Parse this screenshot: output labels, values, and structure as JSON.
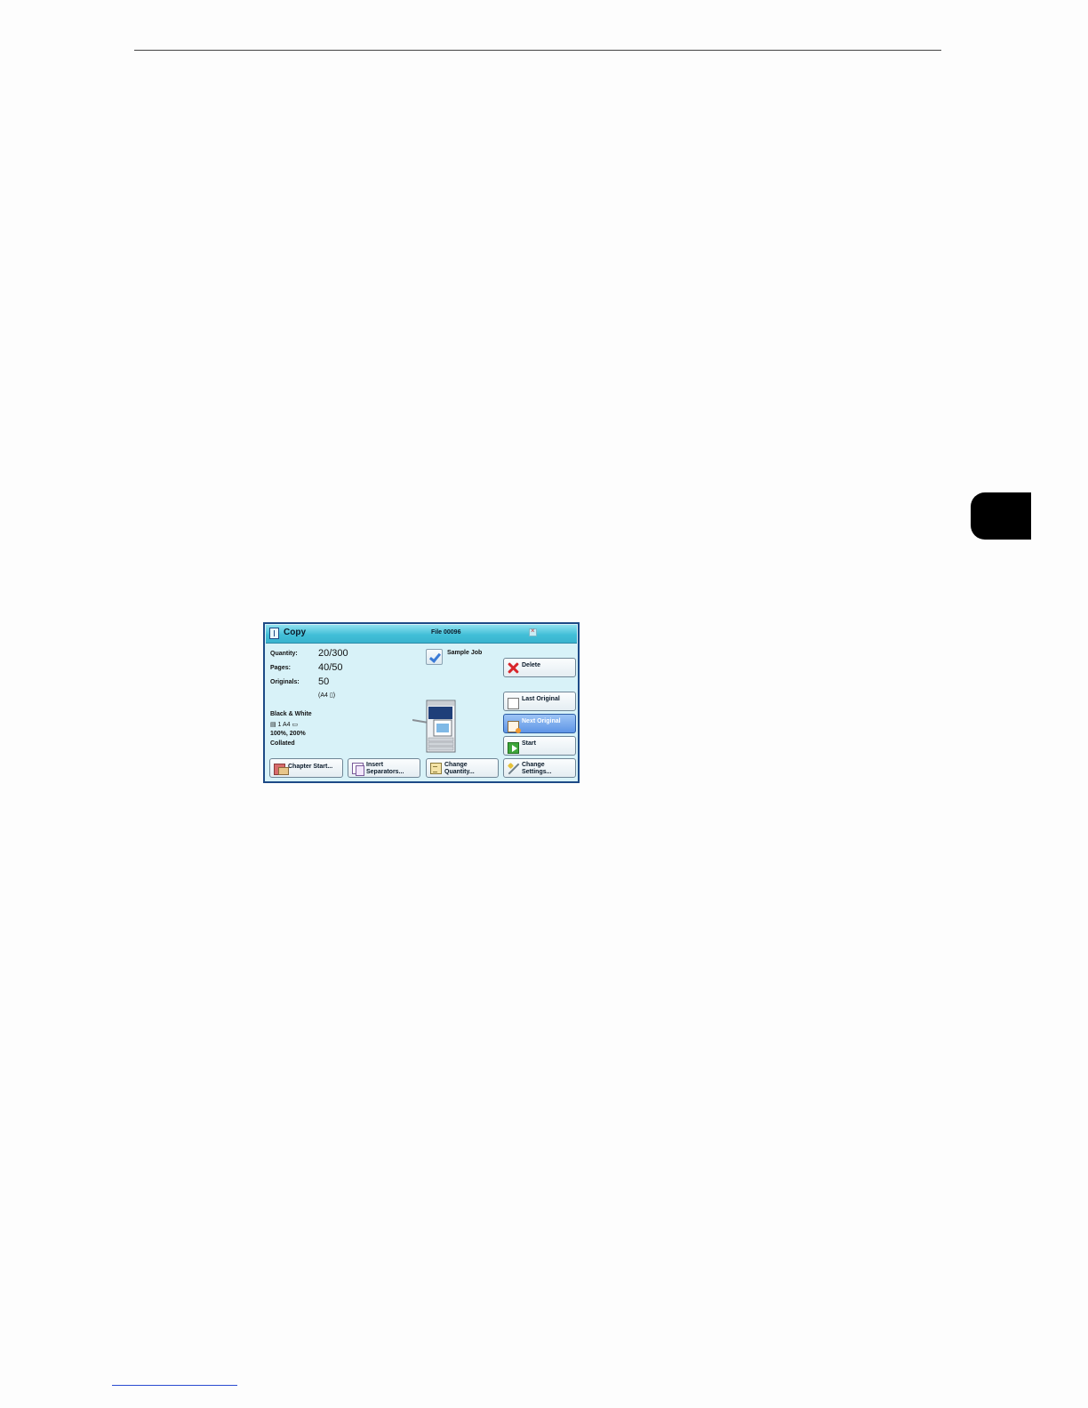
{
  "window": {
    "title": "Copy",
    "file_label": "File 00096"
  },
  "job": {
    "quantity_label": "Quantity:",
    "quantity_value": "20/300",
    "pages_label": "Pages:",
    "pages_value": "40/50",
    "originals_label": "Originals:",
    "originals_value": "50",
    "original_size": "(A4 ▯)",
    "color_mode": "Black & White",
    "tray_paper": "▤ 1    A4 ▭",
    "reduce_enlarge": "100%, 200%",
    "output": "Collated"
  },
  "sample_job": {
    "label": "Sample Job",
    "checked": true
  },
  "actions": {
    "delete": "Delete",
    "last_original": "Last Original",
    "next_original": "Next Original",
    "start": "Start"
  },
  "bottom_buttons": {
    "chapter_start": "Chapter Start...",
    "insert_separators_1": "Insert",
    "insert_separators_2": "Separators...",
    "change_quantity_1": "Change",
    "change_quantity_2": "Quantity...",
    "change_settings_1": "Change",
    "change_settings_2": "Settings..."
  },
  "icons": {
    "window": "copy-icon",
    "close": "close-icon",
    "delete": "delete-x-icon",
    "last_original": "document-icon",
    "next_original": "next-document-icon",
    "start": "start-play-icon",
    "chapter_start": "chapter-icon",
    "insert_separators": "separator-icon",
    "change_quantity": "quantity-icon",
    "change_settings": "settings-wrench-icon",
    "machine": "printer-illustration"
  },
  "colors": {
    "panel_bg": "#d8f2f8",
    "titlebar": "#42bfd8",
    "selected_button": "#5e95e6",
    "delete_red": "#d8262b",
    "start_green": "#3ea63b",
    "chapter_tab": "#000000"
  }
}
